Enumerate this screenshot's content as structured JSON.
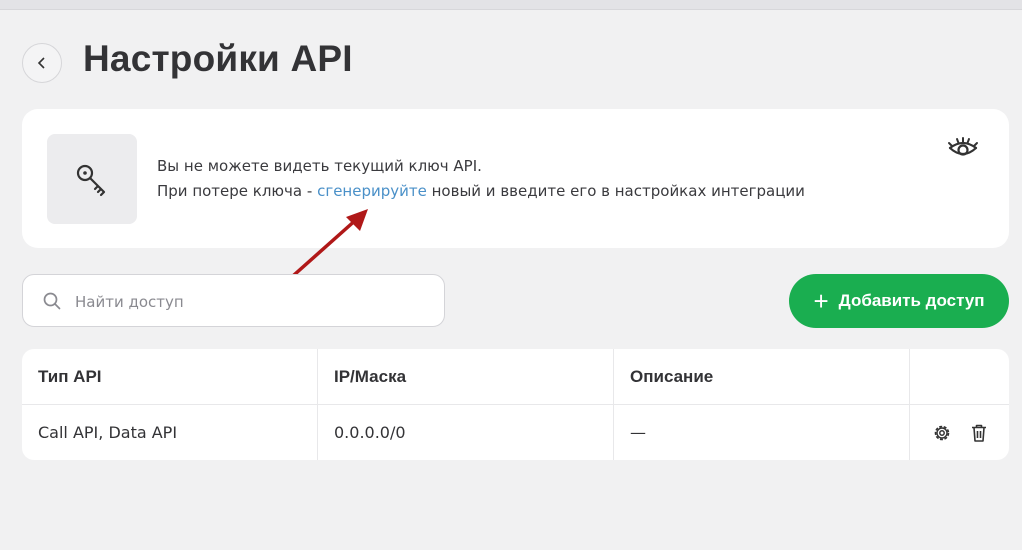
{
  "page": {
    "title": "Настройки API",
    "back_icon": "chevron-left-icon"
  },
  "info": {
    "key_icon": "key-icon",
    "line1": "Вы не можете видеть текущий ключ API.",
    "line2_before": "При потере ключа - ",
    "line2_link": "сгенерируйте",
    "line2_after": " новый и введите его в настройках интеграции",
    "toggle_icon": "eye-closed-icon",
    "link_color": "#4a90c8"
  },
  "search": {
    "placeholder": "Найти доступ",
    "value": "",
    "icon": "search-icon"
  },
  "add_button": {
    "label": "Добавить доступ",
    "icon": "plus-icon",
    "color": "#1aae50"
  },
  "table": {
    "columns": [
      "Тип API",
      "IP/Маска",
      "Описание",
      ""
    ],
    "rows": [
      {
        "type": "Call API, Data API",
        "ip": "0.0.0.0/0",
        "description": "—",
        "actions": [
          "gear-icon",
          "trash-icon"
        ]
      }
    ]
  },
  "annotation": {
    "arrow_color": "#b01818"
  }
}
